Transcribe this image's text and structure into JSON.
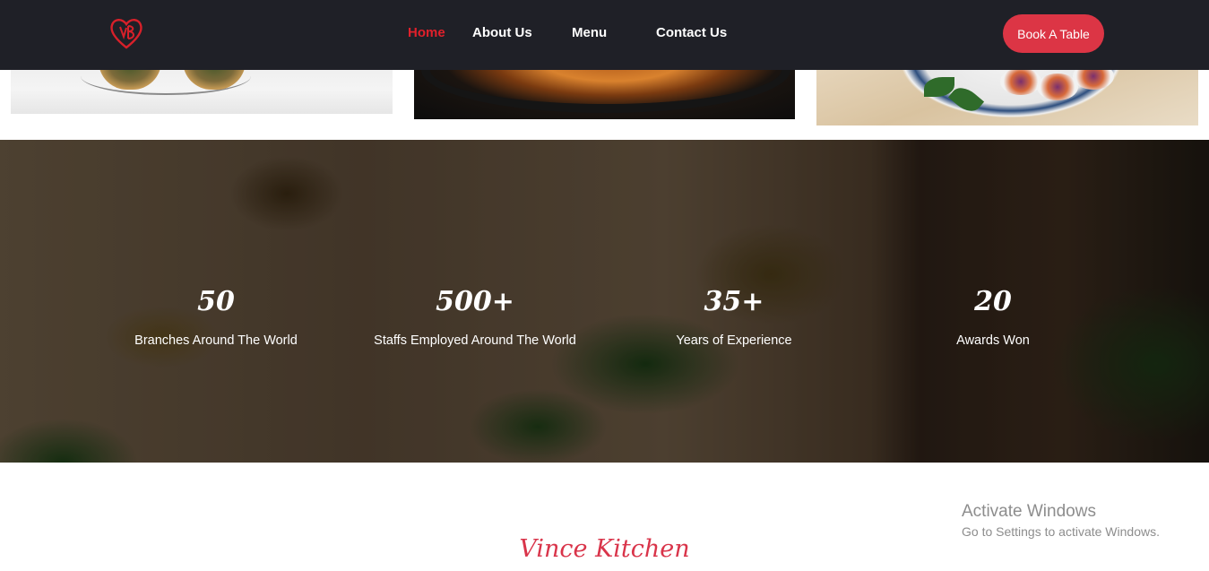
{
  "header": {
    "nav": [
      {
        "label": "Home",
        "active": true
      },
      {
        "label": "About Us",
        "active": false
      },
      {
        "label": "Menu",
        "active": false
      },
      {
        "label": "Contact Us",
        "active": false
      }
    ],
    "book_button": "Book A Table",
    "logo_icon": "heart-monogram-logo",
    "accent_color": "#dc3545",
    "header_bg": "#1f2027"
  },
  "stats": [
    {
      "value": "50",
      "label": "Branches Around The World"
    },
    {
      "value": "500+",
      "label": "Staffs Employed Around The World"
    },
    {
      "value": "35+",
      "label": "Years of Experience"
    },
    {
      "value": "20",
      "label": "Awards Won"
    }
  ],
  "section": {
    "title": "Vince Kitchen"
  },
  "watermark": {
    "line1": "Activate Windows",
    "line2": "Go to Settings to activate Windows."
  }
}
